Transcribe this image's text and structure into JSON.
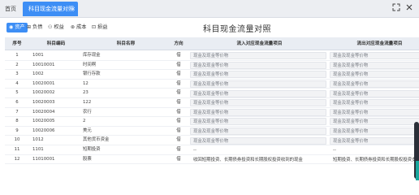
{
  "tabs": {
    "home_label": "首页",
    "active_label": "科目现金流量对照",
    "close_glyph": "×"
  },
  "window_icons": [
    "collapse-icon",
    "close-icon"
  ],
  "toolbar": {
    "items": [
      {
        "label": "资产",
        "icon": "asset-icon",
        "active": true
      },
      {
        "label": "负债",
        "icon": "liability-icon",
        "active": false
      },
      {
        "label": "权益",
        "icon": "equity-icon",
        "active": false
      },
      {
        "label": "成本",
        "icon": "cost-icon",
        "active": false
      },
      {
        "label": "损益",
        "icon": "pl-icon",
        "active": false
      }
    ]
  },
  "page_title": "科目现金流量对照",
  "table": {
    "headers": {
      "no": "序号",
      "code": "科目编码",
      "name": "科目名称",
      "dir": "方向",
      "inflow": "流入对应现金流量项目",
      "outflow": "流出对应现金流量项目"
    },
    "rows": [
      {
        "no": "1",
        "code": "1001",
        "name": "库存现金",
        "dir": "借",
        "inflow": "现金及现金等价物",
        "outflow": "现金及现金等价物"
      },
      {
        "no": "2",
        "code": "10010001",
        "name": "时间啊",
        "dir": "借",
        "inflow": "现金及现金等价物",
        "outflow": "现金及现金等价物"
      },
      {
        "no": "3",
        "code": "1002",
        "name": "银行存款",
        "dir": "借",
        "inflow": "现金及现金等价物",
        "outflow": "现金及现金等价物"
      },
      {
        "no": "4",
        "code": "10020001",
        "name": "12",
        "dir": "借",
        "inflow": "现金及现金等价物",
        "outflow": "现金及现金等价物"
      },
      {
        "no": "5",
        "code": "10020002",
        "name": "23",
        "dir": "借",
        "inflow": "现金及现金等价物",
        "outflow": "现金及现金等价物"
      },
      {
        "no": "6",
        "code": "10020003",
        "name": "122",
        "dir": "借",
        "inflow": "现金及现金等价物",
        "outflow": "现金及现金等价物"
      },
      {
        "no": "7",
        "code": "10020004",
        "name": "农行",
        "dir": "借",
        "inflow": "现金及现金等价物",
        "outflow": "现金及现金等价物"
      },
      {
        "no": "8",
        "code": "10020005",
        "name": "2",
        "dir": "借",
        "inflow": "现金及现金等价物",
        "outflow": "现金及现金等价物"
      },
      {
        "no": "9",
        "code": "10020006",
        "name": "美元",
        "dir": "借",
        "inflow": "现金及现金等价物",
        "outflow": "现金及现金等价物"
      },
      {
        "no": "10",
        "code": "1012",
        "name": "其他货币资金",
        "dir": "借",
        "inflow": "现金及现金等价物",
        "outflow": "现金及现金等价物"
      },
      {
        "no": "11",
        "code": "1101",
        "name": "短期投资",
        "dir": "借",
        "inflow": "--",
        "outflow": "--"
      },
      {
        "no": "12",
        "code": "11010001",
        "name": "股票",
        "dir": "借",
        "inflow": "收回短期投资、长期债券投资和长期股权投资收到的现金",
        "outflow": "短期投资、长期债券投资和长期股权投资支付的现金"
      }
    ]
  }
}
